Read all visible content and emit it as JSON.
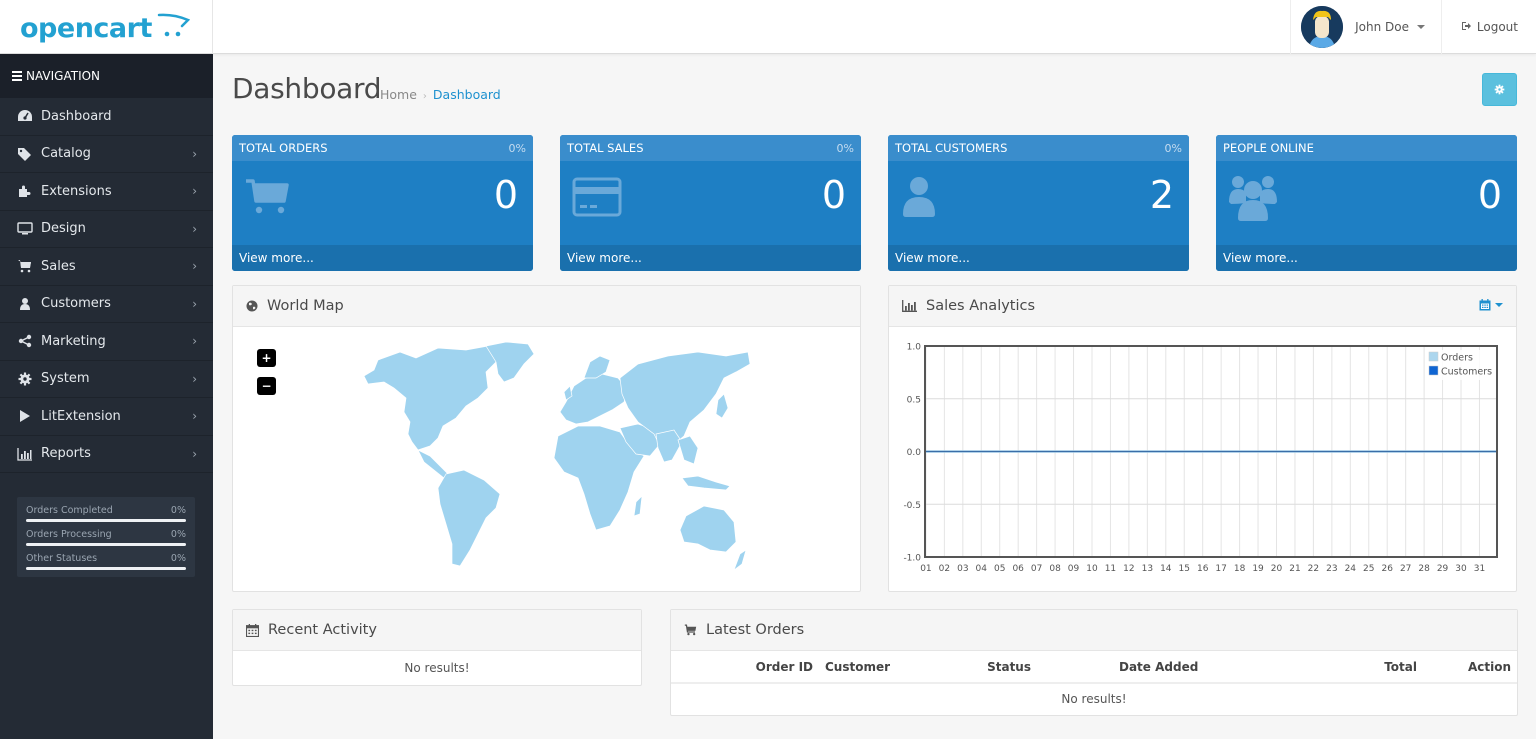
{
  "header": {
    "logo_text": "opencart",
    "user_name": "John Doe",
    "logout_label": "Logout"
  },
  "navigation": {
    "heading": "NAVIGATION",
    "items": [
      {
        "label": "Dashboard",
        "icon": "dashboard-icon",
        "has_submenu": false
      },
      {
        "label": "Catalog",
        "icon": "tags-icon",
        "has_submenu": true
      },
      {
        "label": "Extensions",
        "icon": "puzzle-icon",
        "has_submenu": true
      },
      {
        "label": "Design",
        "icon": "monitor-icon",
        "has_submenu": true
      },
      {
        "label": "Sales",
        "icon": "cart-icon",
        "has_submenu": true
      },
      {
        "label": "Customers",
        "icon": "user-icon",
        "has_submenu": true
      },
      {
        "label": "Marketing",
        "icon": "share-icon",
        "has_submenu": true
      },
      {
        "label": "System",
        "icon": "cog-icon",
        "has_submenu": true
      },
      {
        "label": "LitExtension",
        "icon": "play-icon",
        "has_submenu": true
      },
      {
        "label": "Reports",
        "icon": "bar-chart-icon",
        "has_submenu": true
      }
    ],
    "arrow": "›"
  },
  "order_stats": [
    {
      "label": "Orders Completed",
      "value": "0%",
      "progress": 0
    },
    {
      "label": "Orders Processing",
      "value": "0%",
      "progress": 0
    },
    {
      "label": "Other Statuses",
      "value": "0%",
      "progress": 0
    }
  ],
  "page": {
    "title": "Dashboard",
    "breadcrumb": [
      {
        "label": "Home"
      },
      {
        "label": "Dashboard"
      }
    ],
    "breadcrumb_sep": "›"
  },
  "tiles": [
    {
      "heading": "TOTAL ORDERS",
      "percent": "0%",
      "value": "0",
      "icon": "shopping-cart-icon",
      "footer": "View more..."
    },
    {
      "heading": "TOTAL SALES",
      "percent": "0%",
      "value": "0",
      "icon": "credit-card-icon",
      "footer": "View more..."
    },
    {
      "heading": "TOTAL CUSTOMERS",
      "percent": "0%",
      "value": "2",
      "icon": "user-icon",
      "footer": "View more..."
    },
    {
      "heading": "PEOPLE ONLINE",
      "percent": "",
      "value": "0",
      "icon": "users-icon",
      "footer": "View more..."
    }
  ],
  "world_map": {
    "title": "World Map",
    "zoom_in": "+",
    "zoom_out": "−"
  },
  "sales_analytics": {
    "title": "Sales Analytics"
  },
  "recent_activity": {
    "title": "Recent Activity",
    "empty": "No results!"
  },
  "latest_orders": {
    "title": "Latest Orders",
    "columns": [
      "Order ID",
      "Customer",
      "Status",
      "Date Added",
      "Total",
      "Action"
    ],
    "empty": "No results!"
  },
  "colors": {
    "brand": "#23a1d1",
    "tile_bg": "#1e7fc4",
    "sidebar_bg": "#242b35",
    "map_fill": "#9fd3ef",
    "orders_series": "#acd6ee",
    "customers_series": "#1065d2"
  },
  "chart_data": {
    "type": "line",
    "title": "Sales Analytics",
    "x": [
      "01",
      "02",
      "03",
      "04",
      "05",
      "06",
      "07",
      "08",
      "09",
      "10",
      "11",
      "12",
      "13",
      "14",
      "15",
      "16",
      "17",
      "18",
      "19",
      "20",
      "21",
      "22",
      "23",
      "24",
      "25",
      "26",
      "27",
      "28",
      "29",
      "30",
      "31"
    ],
    "series": [
      {
        "name": "Orders",
        "values": [
          0,
          0,
          0,
          0,
          0,
          0,
          0,
          0,
          0,
          0,
          0,
          0,
          0,
          0,
          0,
          0,
          0,
          0,
          0,
          0,
          0,
          0,
          0,
          0,
          0,
          0,
          0,
          0,
          0,
          0,
          0
        ]
      },
      {
        "name": "Customers",
        "values": [
          0,
          0,
          0,
          0,
          0,
          0,
          0,
          0,
          0,
          0,
          0,
          0,
          0,
          0,
          0,
          0,
          0,
          0,
          0,
          0,
          0,
          0,
          0,
          0,
          0,
          0,
          0,
          0,
          0,
          0,
          0
        ]
      }
    ],
    "yticks": [
      "1.0",
      "0.5",
      "0.0",
      "-0.5",
      "-1.0"
    ],
    "ylim": [
      -1,
      1
    ],
    "xlabel": "",
    "ylabel": "",
    "grid": true,
    "legend": "top-right"
  }
}
